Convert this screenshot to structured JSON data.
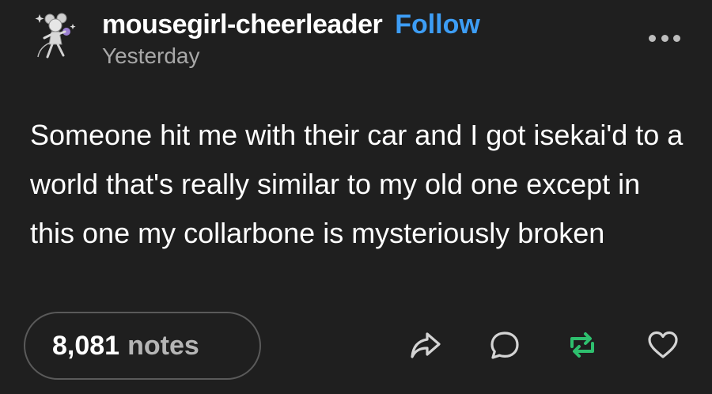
{
  "post": {
    "blog_name": "mousegirl-cheerleader",
    "follow_label": "Follow",
    "timestamp": "Yesterday",
    "body": "Someone hit me with their car and I got isekai'd to a world that's really similar to my old one except in this one my collarbone is mysteriously broken",
    "notes_count": "8,081",
    "notes_label": "notes"
  },
  "colors": {
    "background": "#1f1f1f",
    "follow_link": "#3d9df5",
    "reblog_icon": "#2ebf6e",
    "muted_text": "#a8a8a8"
  },
  "icons": {
    "share": "share-arrow-icon",
    "reply": "speech-bubble-icon",
    "reblog": "reblog-icon",
    "like": "heart-icon",
    "more": "ellipsis-icon"
  }
}
